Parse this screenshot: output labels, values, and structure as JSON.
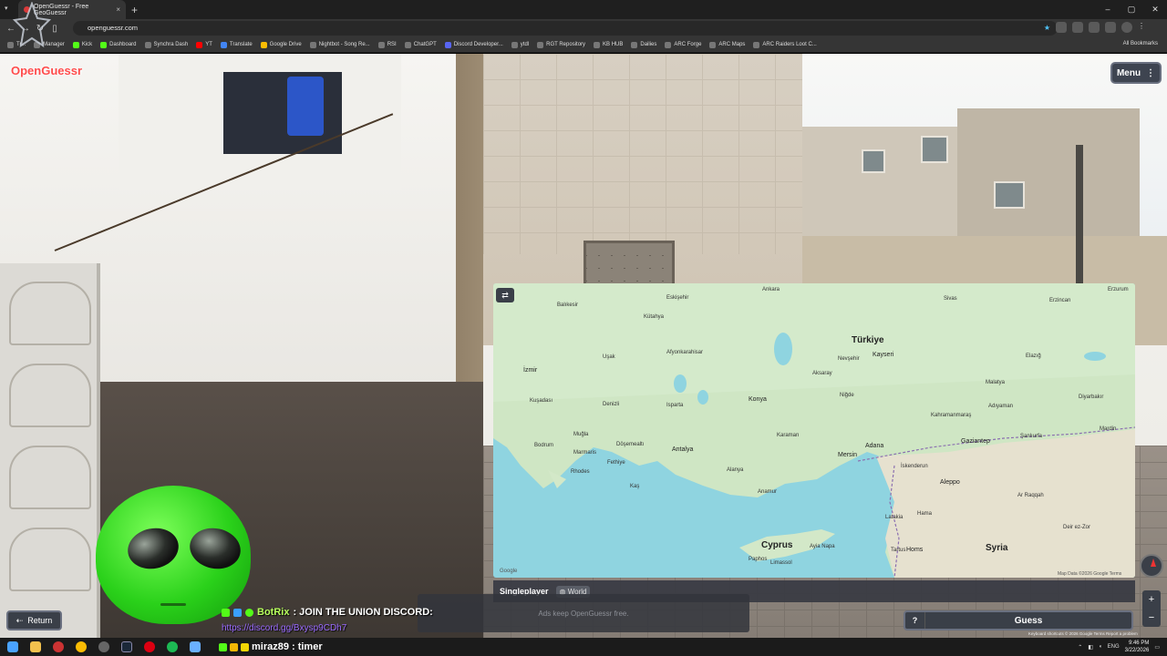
{
  "browser": {
    "tab_title": "OpenGuessr - Free GeoGuessr",
    "url": "openguessr.com",
    "bookmarks": [
      "Tr...",
      "Manager",
      "Kick",
      "Dashboard",
      "Synchra Dash",
      "YT",
      "Translate",
      "Google Drive",
      "Nightbot - Song Re...",
      "RSI",
      "ChatGPT",
      "Discord Developer...",
      "ytdl",
      "RGT Repository",
      "KB HUB",
      "Dailies",
      "ARC Forge",
      "ARC Maps",
      "ARC Raiders Loot C..."
    ],
    "all_bookmarks": "All Bookmarks"
  },
  "app": {
    "brand": "OpenGuessr",
    "menu_label": "Menu",
    "mode_label": "Singleplayer",
    "region_label": "World",
    "ad_text": "Ads keep OpenGuessr free.",
    "return_label": "Return",
    "help_label": "?",
    "guess_label": "Guess",
    "map_filter_icon": "sliders-icon"
  },
  "map": {
    "google_logo": "Google",
    "attribution": "Map Data ©2026 Google   Terms",
    "labels": {
      "ankara": "Ankara",
      "eskisehir": "Eskişehir",
      "balikesir": "Balıkesir",
      "kutahya": "Kütahya",
      "turkiye": "Türkiye",
      "kayseri": "Kayseri",
      "sivas": "Sivas",
      "erzincan": "Erzincan",
      "erzurum": "Erzurum",
      "afyon": "Afyonkarahisar",
      "izmir": "İzmir",
      "usak": "Uşak",
      "aksaray": "Aksaray",
      "nevsehir": "Nevşehir",
      "elazig": "Elazığ",
      "malatya": "Malatya",
      "konya": "Konya",
      "nigde": "Niğde",
      "denizli": "Denizli",
      "isparta": "Isparta",
      "kusadasi": "Kuşadası",
      "karaman": "Karaman",
      "kahramanmaras": "Kahramanmaraş",
      "adiyaman": "Adıyaman",
      "diyarbakir": "Diyarbakır",
      "mugla": "Muğla",
      "antalya": "Antalya",
      "adana": "Adana",
      "mersin": "Mersin",
      "gaziantep": "Gaziantep",
      "sanliurfa": "Şanlıurfa",
      "mardin": "Mardin",
      "bodrum": "Bodrum",
      "marmaris": "Marmaris",
      "rhodes": "Rhodes",
      "fethiye": "Fethiye",
      "alanya": "Alanya",
      "anamur": "Anamur",
      "iskenderun": "İskenderun",
      "aleppo": "Aleppo",
      "ar_raqqah": "Ar Raqqah",
      "latakia": "Latakia",
      "hama": "Hama",
      "deir": "Deir ez-Zor",
      "homs": "Homs",
      "syria": "Syria",
      "cyprus": "Cyprus",
      "tartus": "Tartus",
      "paphos": "Paphos",
      "limassol": "Limassol",
      "ayia_napa": "Ayia Napa",
      "kas": "Kaş",
      "dosemealti": "Döşemealtı"
    }
  },
  "map_controls": {
    "zoom_in": "+",
    "zoom_out": "−"
  },
  "map_footer": "Keyboard shortcuts  © 2026 Google  Terms  Report a problem",
  "stream": {
    "chat1_user": "BotRix",
    "chat1_text": ": JOIN THE UNION DISCORD:",
    "chat1_link": "https://discord.gg/Bxysp9CDh7",
    "chat2_user": "miraz89",
    "chat2_text": ": timer"
  },
  "taskbar": {
    "lang": "ENG",
    "time": "9:46 PM",
    "date": "3/22/2026"
  }
}
